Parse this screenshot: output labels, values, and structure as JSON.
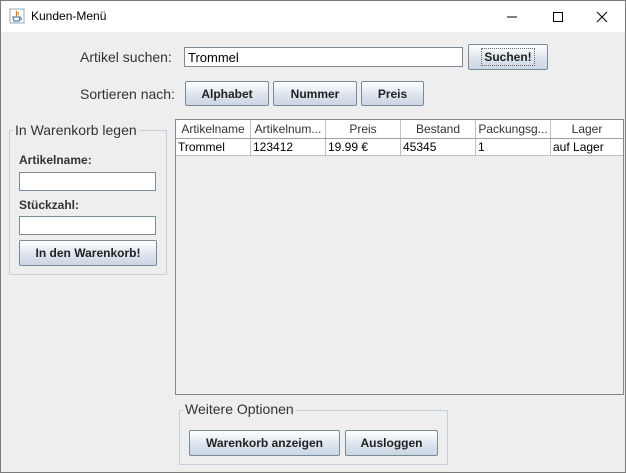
{
  "window": {
    "title": "Kunden-Menü",
    "app_icon": "java-cup-icon",
    "controls": [
      "minimize-icon",
      "maximize-icon",
      "close-icon"
    ]
  },
  "search": {
    "label": "Artikel suchen:",
    "value": "Trommel",
    "button_label": "Suchen!"
  },
  "sort": {
    "label": "Sortieren nach:",
    "buttons": [
      "Alphabet",
      "Nummer",
      "Preis"
    ]
  },
  "cart_panel": {
    "title": "In Warenkorb legen",
    "name_label": "Artikelname:",
    "name_value": "",
    "quantity_label": "Stückzahl:",
    "quantity_value": "",
    "add_button_label": "In den Warenkorb!"
  },
  "table": {
    "columns": [
      "Artikelname",
      "Artikelnum...",
      "Preis",
      "Bestand",
      "Packungsg...",
      "Lager"
    ],
    "rows": [
      [
        "Trommel",
        "123412",
        "19.99 €",
        "45345",
        "1",
        "auf Lager"
      ]
    ]
  },
  "options": {
    "title": "Weitere Optionen",
    "show_cart_label": "Warenkorb anzeigen",
    "logout_label": "Ausloggen"
  }
}
